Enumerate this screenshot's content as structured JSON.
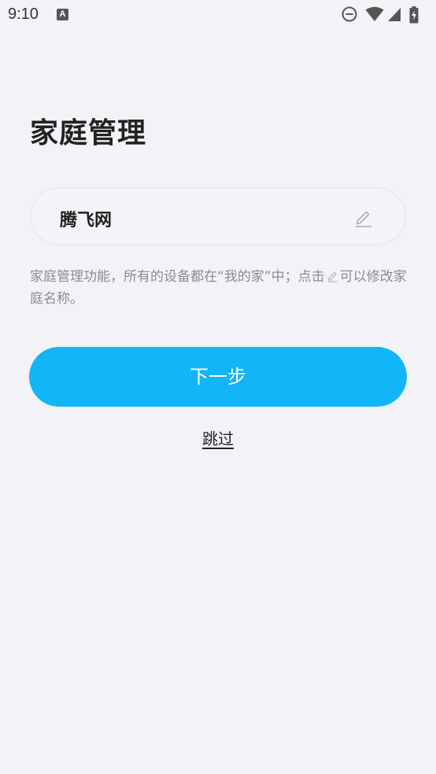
{
  "status_bar": {
    "time": "9:10",
    "notification_icon": "A",
    "icons": [
      "do-not-disturb-icon",
      "wifi-icon",
      "cell-signal-icon",
      "battery-charging-icon"
    ]
  },
  "page": {
    "title": "家庭管理"
  },
  "home_name_field": {
    "value": "腾飞网",
    "edit_icon": "pencil-icon"
  },
  "hint": {
    "text_before": "家庭管理功能，所有的设备都在“我的家”中；点击",
    "inline_icon": "pencil-icon",
    "text_after": "可以修改家庭名称。"
  },
  "actions": {
    "next_label": "下一步",
    "skip_label": "跳过"
  },
  "colors": {
    "background": "#f3f2f7",
    "primary_button": "#12b6f7",
    "hint_text": "#8b8b90"
  }
}
